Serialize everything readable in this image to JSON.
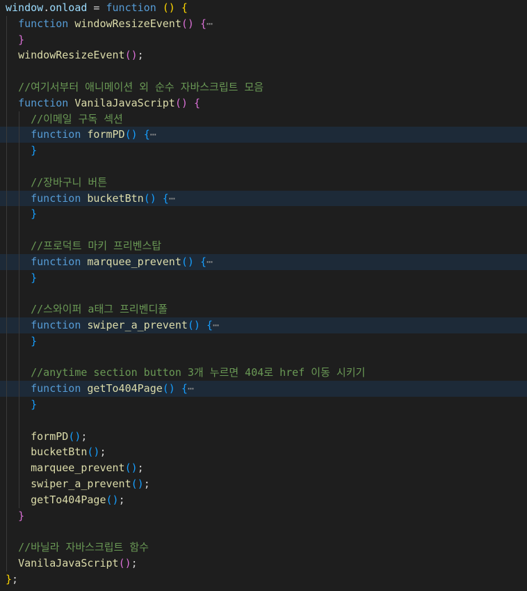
{
  "colors": {
    "background": "#1e1e1e",
    "keyword": "#569cd6",
    "function": "#dcdcaa",
    "variable": "#9cdcfe",
    "comment": "#6a9955",
    "bracket_level_1": "#ffd700",
    "bracket_level_2": "#da70d6",
    "bracket_level_3": "#179fff"
  },
  "lines": [
    {
      "hl": false,
      "sticky": true,
      "indent": 0,
      "tokens": [
        {
          "t": "window",
          "c": "id"
        },
        {
          "t": ".",
          "c": "pl"
        },
        {
          "t": "onload",
          "c": "id"
        },
        {
          "t": " = ",
          "c": "pl"
        },
        {
          "t": "function",
          "c": "kw"
        },
        {
          "t": " ",
          "c": "pl"
        },
        {
          "t": "()",
          "c": "b1"
        },
        {
          "t": " ",
          "c": "pl"
        },
        {
          "t": "{",
          "c": "b1"
        }
      ]
    },
    {
      "hl": false,
      "sticky": true,
      "indent": 1,
      "tokens": [
        {
          "t": "  ",
          "c": "pl"
        },
        {
          "t": "function",
          "c": "kw"
        },
        {
          "t": " ",
          "c": "pl"
        },
        {
          "t": "windowResizeEvent",
          "c": "fn"
        },
        {
          "t": "()",
          "c": "b2"
        },
        {
          "t": " ",
          "c": "pl"
        },
        {
          "t": "{",
          "c": "b2"
        },
        {
          "t": "⋯",
          "c": "el"
        }
      ]
    },
    {
      "hl": false,
      "indent": 1,
      "tokens": [
        {
          "t": "  ",
          "c": "pl"
        },
        {
          "t": "}",
          "c": "b2"
        }
      ]
    },
    {
      "hl": false,
      "indent": 1,
      "tokens": [
        {
          "t": "  ",
          "c": "pl"
        },
        {
          "t": "windowResizeEvent",
          "c": "fn"
        },
        {
          "t": "()",
          "c": "b2"
        },
        {
          "t": ";",
          "c": "pl"
        }
      ]
    },
    {
      "hl": false,
      "indent": 1,
      "tokens": []
    },
    {
      "hl": false,
      "indent": 1,
      "tokens": [
        {
          "t": "  ",
          "c": "pl"
        },
        {
          "t": "//여기서부터 애니메이션 외 순수 자바스크립트 모음",
          "c": "cm"
        }
      ]
    },
    {
      "hl": false,
      "indent": 1,
      "tokens": [
        {
          "t": "  ",
          "c": "pl"
        },
        {
          "t": "function",
          "c": "kw"
        },
        {
          "t": " ",
          "c": "pl"
        },
        {
          "t": "VanilaJavaScript",
          "c": "fn"
        },
        {
          "t": "()",
          "c": "b2"
        },
        {
          "t": " ",
          "c": "pl"
        },
        {
          "t": "{",
          "c": "b2"
        }
      ]
    },
    {
      "hl": false,
      "indent": 2,
      "tokens": [
        {
          "t": "    ",
          "c": "pl"
        },
        {
          "t": "//이메일 구독 섹션",
          "c": "cm"
        }
      ]
    },
    {
      "hl": true,
      "indent": 2,
      "tokens": [
        {
          "t": "    ",
          "c": "pl"
        },
        {
          "t": "function",
          "c": "kw"
        },
        {
          "t": " ",
          "c": "pl"
        },
        {
          "t": "formPD",
          "c": "fn"
        },
        {
          "t": "()",
          "c": "b3"
        },
        {
          "t": " ",
          "c": "pl"
        },
        {
          "t": "{",
          "c": "b3"
        },
        {
          "t": "⋯",
          "c": "el"
        }
      ]
    },
    {
      "hl": false,
      "indent": 2,
      "tokens": [
        {
          "t": "    ",
          "c": "pl"
        },
        {
          "t": "}",
          "c": "b3"
        }
      ]
    },
    {
      "hl": false,
      "indent": 2,
      "tokens": []
    },
    {
      "hl": false,
      "indent": 2,
      "tokens": [
        {
          "t": "    ",
          "c": "pl"
        },
        {
          "t": "//장바구니 버튼",
          "c": "cm"
        }
      ]
    },
    {
      "hl": true,
      "indent": 2,
      "tokens": [
        {
          "t": "    ",
          "c": "pl"
        },
        {
          "t": "function",
          "c": "kw"
        },
        {
          "t": " ",
          "c": "pl"
        },
        {
          "t": "bucketBtn",
          "c": "fn"
        },
        {
          "t": "()",
          "c": "b3"
        },
        {
          "t": " ",
          "c": "pl"
        },
        {
          "t": "{",
          "c": "b3"
        },
        {
          "t": "⋯",
          "c": "el"
        }
      ]
    },
    {
      "hl": false,
      "indent": 2,
      "tokens": [
        {
          "t": "    ",
          "c": "pl"
        },
        {
          "t": "}",
          "c": "b3"
        }
      ]
    },
    {
      "hl": false,
      "indent": 2,
      "tokens": []
    },
    {
      "hl": false,
      "indent": 2,
      "tokens": [
        {
          "t": "    ",
          "c": "pl"
        },
        {
          "t": "//프로덕트 마키 프리벤스탑",
          "c": "cm"
        }
      ]
    },
    {
      "hl": true,
      "indent": 2,
      "tokens": [
        {
          "t": "    ",
          "c": "pl"
        },
        {
          "t": "function",
          "c": "kw"
        },
        {
          "t": " ",
          "c": "pl"
        },
        {
          "t": "marquee_prevent",
          "c": "fn"
        },
        {
          "t": "()",
          "c": "b3"
        },
        {
          "t": " ",
          "c": "pl"
        },
        {
          "t": "{",
          "c": "b3"
        },
        {
          "t": "⋯",
          "c": "el"
        }
      ]
    },
    {
      "hl": false,
      "indent": 2,
      "tokens": [
        {
          "t": "    ",
          "c": "pl"
        },
        {
          "t": "}",
          "c": "b3"
        }
      ]
    },
    {
      "hl": false,
      "indent": 2,
      "tokens": []
    },
    {
      "hl": false,
      "indent": 2,
      "tokens": [
        {
          "t": "    ",
          "c": "pl"
        },
        {
          "t": "//스와이퍼 a태그 프리벤디폴",
          "c": "cm"
        }
      ]
    },
    {
      "hl": true,
      "indent": 2,
      "tokens": [
        {
          "t": "    ",
          "c": "pl"
        },
        {
          "t": "function",
          "c": "kw"
        },
        {
          "t": " ",
          "c": "pl"
        },
        {
          "t": "swiper_a_prevent",
          "c": "fn"
        },
        {
          "t": "()",
          "c": "b3"
        },
        {
          "t": " ",
          "c": "pl"
        },
        {
          "t": "{",
          "c": "b3"
        },
        {
          "t": "⋯",
          "c": "el"
        }
      ]
    },
    {
      "hl": false,
      "indent": 2,
      "tokens": [
        {
          "t": "    ",
          "c": "pl"
        },
        {
          "t": "}",
          "c": "b3"
        }
      ]
    },
    {
      "hl": false,
      "indent": 2,
      "tokens": []
    },
    {
      "hl": false,
      "indent": 2,
      "tokens": [
        {
          "t": "    ",
          "c": "pl"
        },
        {
          "t": "//anytime section button 3개 누르면 404로 href 이동 시키기",
          "c": "cm"
        }
      ]
    },
    {
      "hl": true,
      "indent": 2,
      "tokens": [
        {
          "t": "    ",
          "c": "pl"
        },
        {
          "t": "function",
          "c": "kw"
        },
        {
          "t": " ",
          "c": "pl"
        },
        {
          "t": "getTo404Page",
          "c": "fn"
        },
        {
          "t": "()",
          "c": "b3"
        },
        {
          "t": " ",
          "c": "pl"
        },
        {
          "t": "{",
          "c": "b3"
        },
        {
          "t": "⋯",
          "c": "el"
        }
      ]
    },
    {
      "hl": false,
      "indent": 2,
      "tokens": [
        {
          "t": "    ",
          "c": "pl"
        },
        {
          "t": "}",
          "c": "b3"
        }
      ]
    },
    {
      "hl": false,
      "indent": 2,
      "tokens": []
    },
    {
      "hl": false,
      "indent": 2,
      "tokens": [
        {
          "t": "    ",
          "c": "pl"
        },
        {
          "t": "formPD",
          "c": "fn"
        },
        {
          "t": "()",
          "c": "b3"
        },
        {
          "t": ";",
          "c": "pl"
        }
      ]
    },
    {
      "hl": false,
      "indent": 2,
      "tokens": [
        {
          "t": "    ",
          "c": "pl"
        },
        {
          "t": "bucketBtn",
          "c": "fn"
        },
        {
          "t": "()",
          "c": "b3"
        },
        {
          "t": ";",
          "c": "pl"
        }
      ]
    },
    {
      "hl": false,
      "indent": 2,
      "tokens": [
        {
          "t": "    ",
          "c": "pl"
        },
        {
          "t": "marquee_prevent",
          "c": "fn"
        },
        {
          "t": "()",
          "c": "b3"
        },
        {
          "t": ";",
          "c": "pl"
        }
      ]
    },
    {
      "hl": false,
      "indent": 2,
      "tokens": [
        {
          "t": "    ",
          "c": "pl"
        },
        {
          "t": "swiper_a_prevent",
          "c": "fn"
        },
        {
          "t": "()",
          "c": "b3"
        },
        {
          "t": ";",
          "c": "pl"
        }
      ]
    },
    {
      "hl": false,
      "indent": 2,
      "tokens": [
        {
          "t": "    ",
          "c": "pl"
        },
        {
          "t": "getTo404Page",
          "c": "fn"
        },
        {
          "t": "()",
          "c": "b3"
        },
        {
          "t": ";",
          "c": "pl"
        }
      ]
    },
    {
      "hl": false,
      "indent": 1,
      "tokens": [
        {
          "t": "  ",
          "c": "pl"
        },
        {
          "t": "}",
          "c": "b2"
        }
      ]
    },
    {
      "hl": false,
      "indent": 1,
      "tokens": []
    },
    {
      "hl": false,
      "indent": 1,
      "tokens": [
        {
          "t": "  ",
          "c": "pl"
        },
        {
          "t": "//바닐라 자바스크립트 함수",
          "c": "cm"
        }
      ]
    },
    {
      "hl": false,
      "indent": 1,
      "tokens": [
        {
          "t": "  ",
          "c": "pl"
        },
        {
          "t": "VanilaJavaScript",
          "c": "fn"
        },
        {
          "t": "()",
          "c": "b2"
        },
        {
          "t": ";",
          "c": "pl"
        }
      ]
    },
    {
      "hl": false,
      "indent": 0,
      "tokens": [
        {
          "t": "}",
          "c": "b1"
        },
        {
          "t": ";",
          "c": "pl"
        }
      ]
    }
  ]
}
